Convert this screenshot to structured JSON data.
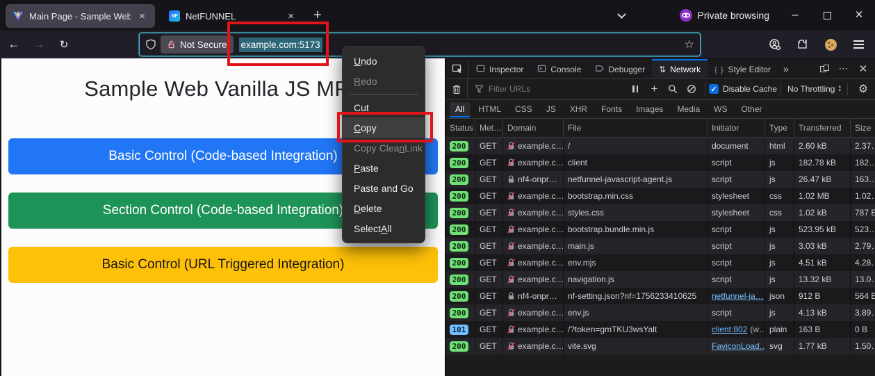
{
  "colors": {
    "annotation_red": "#e0151b",
    "devtools_accent_blue": "#0074e8",
    "badge_green": "#6fdf77",
    "badge_blue": "#75bfff",
    "link_blue": "#75bfff",
    "url_selection_teal": "#2d6676",
    "urlbar_focus_border": "#45bcd9"
  },
  "titlebar": {
    "tabs": [
      {
        "title": "Main Page - Sample Web",
        "icon": "vite-icon",
        "active": true
      },
      {
        "title": "NetFUNNEL",
        "icon": "netfunnel-icon",
        "active": false
      }
    ],
    "new_tab_label": "+",
    "private_label": "Private browsing",
    "window_controls": [
      "minimize-icon",
      "maximize-icon",
      "close-icon"
    ]
  },
  "navbar": {
    "icons": [
      "back-icon",
      "forward-icon",
      "reload-icon",
      "shield-icon",
      "insecure-lock-icon",
      "bookmark-star-icon",
      "account-icon",
      "extensions-icon",
      "cookie-icon",
      "menu-icon"
    ],
    "security_chip": "Not Secure",
    "url_selected": "example.com:5173"
  },
  "context_menu": {
    "items": [
      {
        "label": "Undo",
        "key_index": 0
      },
      {
        "label": "Redo",
        "key_index": 0,
        "disabled": true
      },
      {
        "separator": true
      },
      {
        "label": "Cut",
        "key_index": 2
      },
      {
        "label": "Copy",
        "key_index": 0,
        "highlighted": true
      },
      {
        "label": "Copy Clean Link",
        "key_index": 9,
        "disabled": true
      },
      {
        "label": "Paste",
        "key_index": 0
      },
      {
        "label": "Paste and Go",
        "key_index": -1
      },
      {
        "label": "Delete",
        "key_index": 0
      },
      {
        "label": "Select All",
        "key_index": 7
      }
    ]
  },
  "page": {
    "heading": "Sample Web Vanilla JS MPA",
    "buttons": [
      {
        "label": "Basic Control (Code-based Integration)",
        "bg": "#2176f5",
        "fg": "#ffffff"
      },
      {
        "label": "Section Control (Code-based Integration)",
        "bg": "#1e9358",
        "fg": "#ffffff"
      },
      {
        "label": "Basic Control (URL Triggered Integration)",
        "bg": "#ffc107",
        "fg": "#151515"
      }
    ]
  },
  "devtools": {
    "tabs": [
      {
        "label": "Inspector",
        "icon": "inspector-icon",
        "active": false
      },
      {
        "label": "Console",
        "icon": "console-icon",
        "active": false
      },
      {
        "label": "Debugger",
        "icon": "debugger-icon",
        "active": false
      },
      {
        "label": "Network",
        "icon": "network-icon",
        "active": true
      },
      {
        "label": "Style Editor",
        "icon": "style-editor-icon",
        "active": false
      }
    ],
    "overflow_label": "»",
    "toolbar": {
      "icons": [
        "trash-icon",
        "funnel-icon",
        "pause-icon",
        "plus-icon",
        "search-icon",
        "block-icon",
        "gear-icon"
      ],
      "filter_placeholder": "Filter URLs",
      "disable_cache_label": "Disable Cache",
      "throttling_value": "No Throttling"
    },
    "filters": [
      {
        "label": "All",
        "active": true
      },
      {
        "label": "HTML"
      },
      {
        "label": "CSS"
      },
      {
        "label": "JS"
      },
      {
        "label": "XHR"
      },
      {
        "label": "Fonts"
      },
      {
        "label": "Images"
      },
      {
        "label": "Media"
      },
      {
        "label": "WS"
      },
      {
        "label": "Other"
      }
    ],
    "columns": [
      "Status",
      "Met…",
      "Domain",
      "File",
      "Initiator",
      "Type",
      "Transferred",
      "Size"
    ],
    "requests": [
      {
        "status": "200",
        "status_color": "green",
        "method": "GET",
        "domain": "example.c…",
        "domain_icon": "insecure-lock-icon",
        "file": "/",
        "initiator": {
          "text": "document"
        },
        "type": "html",
        "transferred": "2.60 kB",
        "size": "2.37…"
      },
      {
        "status": "200",
        "status_color": "green",
        "method": "GET",
        "domain": "example.c…",
        "domain_icon": "insecure-lock-icon",
        "file": "client",
        "initiator": {
          "text": "script"
        },
        "type": "js",
        "transferred": "182.78 kB",
        "size": "182…"
      },
      {
        "status": "200",
        "status_color": "green",
        "method": "GET",
        "domain": "nf4-onpr…",
        "domain_icon": "lock-icon",
        "file": "netfunnel-javascript-agent.js",
        "initiator": {
          "text": "script"
        },
        "type": "js",
        "transferred": "26.47 kB",
        "size": "163…"
      },
      {
        "status": "200",
        "status_color": "green",
        "method": "GET",
        "domain": "example.c…",
        "domain_icon": "insecure-lock-icon",
        "file": "bootstrap.min.css",
        "initiator": {
          "text": "stylesheet"
        },
        "type": "css",
        "transferred": "1.02 MB",
        "size": "1.02…"
      },
      {
        "status": "200",
        "status_color": "green",
        "method": "GET",
        "domain": "example.c…",
        "domain_icon": "insecure-lock-icon",
        "file": "styles.css",
        "initiator": {
          "text": "stylesheet"
        },
        "type": "css",
        "transferred": "1.02 kB",
        "size": "787 B"
      },
      {
        "status": "200",
        "status_color": "green",
        "method": "GET",
        "domain": "example.c…",
        "domain_icon": "insecure-lock-icon",
        "file": "bootstrap.bundle.min.js",
        "initiator": {
          "text": "script"
        },
        "type": "js",
        "transferred": "523.95 kB",
        "size": "523…"
      },
      {
        "status": "200",
        "status_color": "green",
        "method": "GET",
        "domain": "example.c…",
        "domain_icon": "insecure-lock-icon",
        "file": "main.js",
        "initiator": {
          "text": "script"
        },
        "type": "js",
        "transferred": "3.03 kB",
        "size": "2.79…"
      },
      {
        "status": "200",
        "status_color": "green",
        "method": "GET",
        "domain": "example.c…",
        "domain_icon": "insecure-lock-icon",
        "file": "env.mjs",
        "initiator": {
          "text": "script"
        },
        "type": "js",
        "transferred": "4.51 kB",
        "size": "4.28…"
      },
      {
        "status": "200",
        "status_color": "green",
        "method": "GET",
        "domain": "example.c…",
        "domain_icon": "insecure-lock-icon",
        "file": "navigation.js",
        "initiator": {
          "text": "script"
        },
        "type": "js",
        "transferred": "13.32 kB",
        "size": "13.0…"
      },
      {
        "status": "200",
        "status_color": "green",
        "method": "GET",
        "domain": "nf4-onpr…",
        "domain_icon": "lock-icon",
        "file": "nf-setting.json?nf=1756233410625",
        "initiator": {
          "link": "netfunnel-ja…"
        },
        "type": "json",
        "transferred": "912 B",
        "size": "564 B"
      },
      {
        "status": "200",
        "status_color": "green",
        "method": "GET",
        "domain": "example.c…",
        "domain_icon": "insecure-lock-icon",
        "file": "env.js",
        "initiator": {
          "text": "script"
        },
        "type": "js",
        "transferred": "4.13 kB",
        "size": "3.89…"
      },
      {
        "status": "101",
        "status_color": "blue",
        "method": "GET",
        "domain": "example.c…",
        "domain_icon": "insecure-lock-icon",
        "file": "/?token=gmTKU3wsYalt",
        "initiator": {
          "link": "client:802",
          "suffix": " (w…"
        },
        "type": "plain",
        "transferred": "163 B",
        "size": "0 B"
      },
      {
        "status": "200",
        "status_color": "green",
        "method": "GET",
        "domain": "example.c…",
        "domain_icon": "insecure-lock-icon",
        "file": "vite.svg",
        "initiator": {
          "link": "FaviconLoad…"
        },
        "type": "svg",
        "transferred": "1.77 kB",
        "size": "1.50…"
      }
    ]
  }
}
